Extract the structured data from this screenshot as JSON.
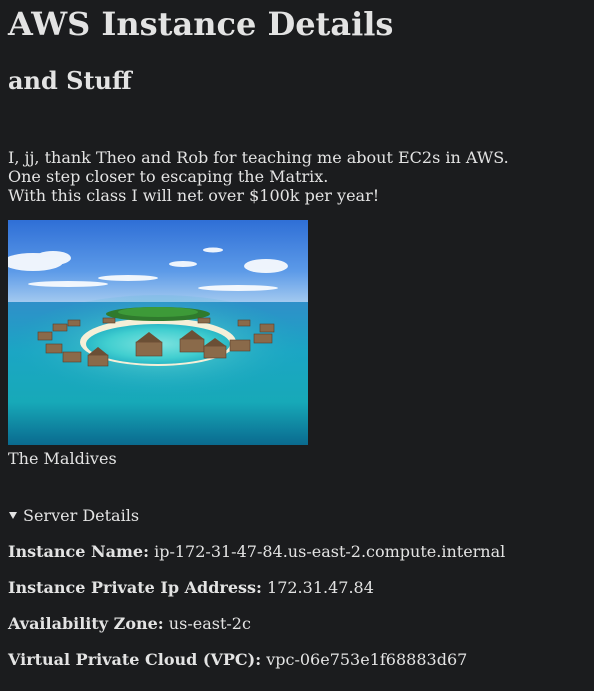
{
  "page": {
    "title": "AWS Instance Details",
    "subtitle": "and Stuff",
    "message_lines": [
      "I, jj, thank Theo and Rob for teaching me about EC2s in AWS.",
      "One step closer to escaping the Matrix.",
      "With this class I will net over $100k per year!"
    ],
    "image_caption": "The Maldives",
    "details_summary": "Server Details",
    "details": [
      {
        "label": "Instance Name:",
        "value": "ip-172-31-47-84.us-east-2.compute.internal"
      },
      {
        "label": "Instance Private Ip Address:",
        "value": "172.31.47.84"
      },
      {
        "label": "Availability Zone:",
        "value": "us-east-2c"
      },
      {
        "label": "Virtual Private Cloud (VPC):",
        "value": "vpc-06e753e1f68883d67"
      }
    ]
  },
  "colors": {
    "background": "#1b1c1e",
    "text": "#e3e3e3"
  },
  "icons": {
    "summary_marker": "disclosure-triangle-down-icon"
  }
}
